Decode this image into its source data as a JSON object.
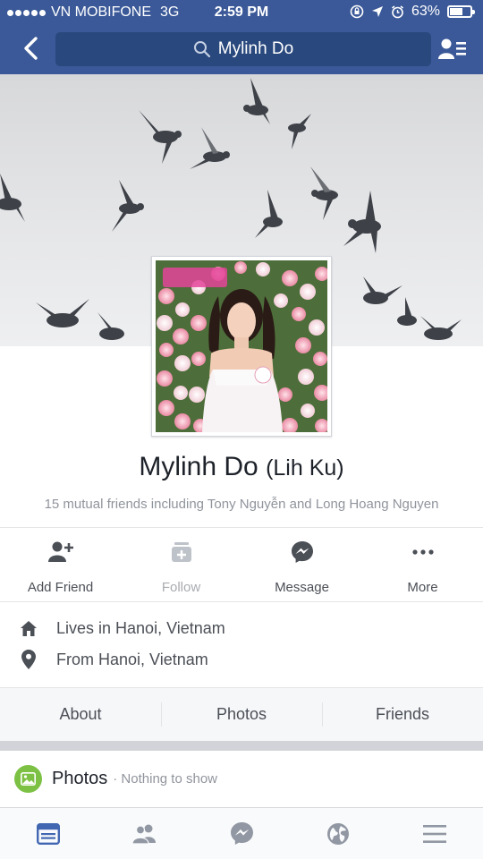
{
  "status_bar": {
    "carrier": "VN MOBIFONE",
    "network": "3G",
    "time": "2:59 PM",
    "battery": "63%",
    "battery_level": 0.63
  },
  "header": {
    "search_text": "Mylinh Do",
    "icons": [
      "back-icon",
      "search-icon",
      "friend-requests-icon"
    ]
  },
  "profile": {
    "name": "Mylinh Do",
    "nickname": "(Lih Ku)",
    "mutual_friends": "15 mutual friends including Tony Nguyễn and Long Hoang Nguyen"
  },
  "actions": [
    {
      "label": "Add Friend",
      "icon": "add-friend-icon"
    },
    {
      "label": "Follow",
      "icon": "follow-icon",
      "disabled": true
    },
    {
      "label": "Message",
      "icon": "messenger-icon"
    },
    {
      "label": "More",
      "icon": "more-icon"
    }
  ],
  "info": [
    {
      "text": "Lives in Hanoi, Vietnam",
      "icon": "home-icon"
    },
    {
      "text": "From Hanoi, Vietnam",
      "icon": "location-pin-icon"
    }
  ],
  "tabs": [
    "About",
    "Photos",
    "Friends"
  ],
  "photos_section": {
    "title": "Photos",
    "subtitle": "· Nothing to show"
  },
  "bottom_nav": [
    "news-feed-icon",
    "friends-icon",
    "messenger-icon",
    "globe-notifications-icon",
    "menu-icon"
  ],
  "colors": {
    "brand_blue": "#3b5998",
    "active_nav": "#4267b2",
    "photos_green": "#7cc144"
  }
}
